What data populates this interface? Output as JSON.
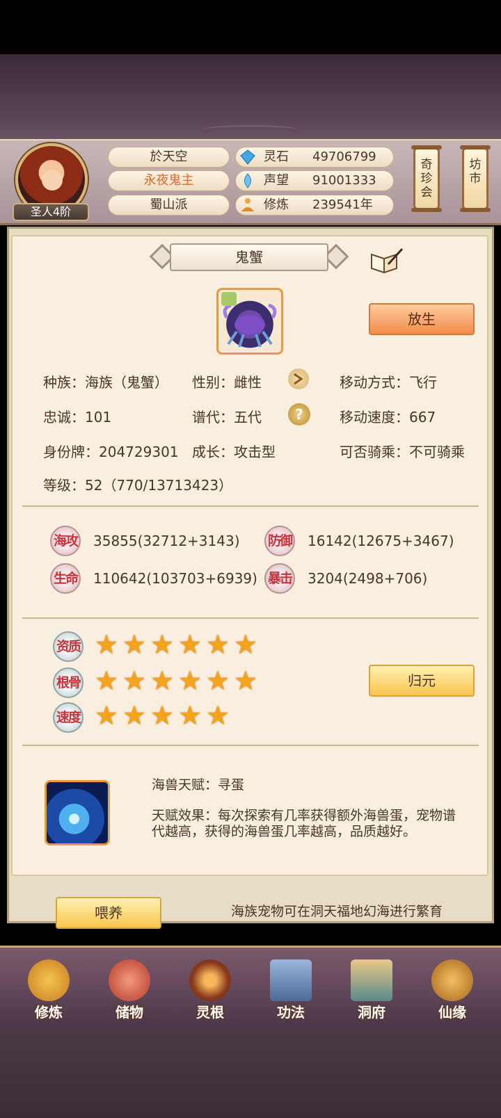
{
  "header": {
    "rank": "圣人4阶",
    "player_name": "於天空",
    "title": "永夜鬼主",
    "sect": "蜀山派",
    "resources": [
      {
        "label": "灵石",
        "value": "49706799",
        "icon": "gem-icon"
      },
      {
        "label": "声望",
        "value": "91001333",
        "icon": "flame-crystal-icon"
      },
      {
        "label": "修炼",
        "value": "239541年",
        "icon": "meditation-icon"
      }
    ],
    "side_buttons": [
      "奇珍会",
      "坊市"
    ]
  },
  "pet": {
    "name": "鬼蟹",
    "release_button": "放生",
    "info": {
      "race": "种族：海族（鬼蟹）",
      "gender": "性别：雌性",
      "move_type": "移动方式：飞行",
      "loyalty": "忠诚：101",
      "generation": "谱代：五代",
      "move_speed": "移动速度：667",
      "id": "身份牌：204729301",
      "growth": "成长：攻击型",
      "rideable": "可否骑乘：不可骑乘",
      "level": "等级：52（770/13713423）"
    },
    "stats": [
      {
        "badge": "海攻",
        "value": "35855(32712+3143)"
      },
      {
        "badge": "防御",
        "value": "16142(12675+3467)"
      },
      {
        "badge": "生命",
        "value": "110642(103703+6939)"
      },
      {
        "badge": "暴击",
        "value": "3204(2498+706)"
      }
    ],
    "qualities": [
      {
        "label": "资质",
        "stars": 6
      },
      {
        "label": "根骨",
        "stars": 6
      },
      {
        "label": "速度",
        "stars": 5
      }
    ],
    "reset_button": "归元",
    "talent_name": "海兽天赋：寻蛋",
    "talent_effect": "天赋效果：每次探索有几率获得额外海兽蛋，宠物谱代越高，获得的海兽蛋几率越高，品质越好。",
    "feed_button": "喂养",
    "tip": "海族宠物可在洞天福地幻海进行繁育"
  },
  "nav": [
    "修炼",
    "储物",
    "灵根",
    "功法",
    "洞府",
    "仙缘"
  ],
  "colors": {
    "accent_orange": "#f28d4a",
    "gold": "#f8c54d",
    "title_orange": "#e0692a",
    "star": "#f7a21b"
  }
}
